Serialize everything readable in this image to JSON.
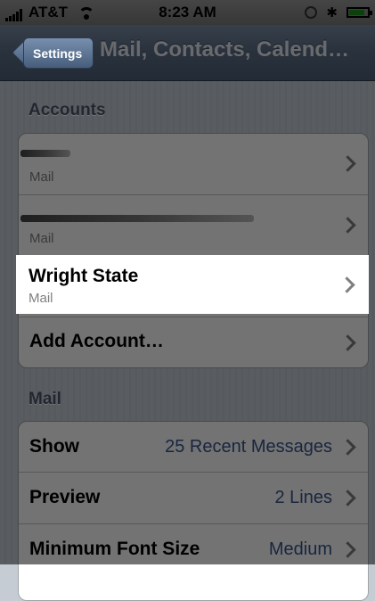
{
  "status_bar": {
    "carrier": "AT&T",
    "time": "8:23 AM",
    "battery_level": 0.9
  },
  "nav": {
    "back_label": "Settings",
    "title": "Mail, Contacts, Calend…"
  },
  "accounts_section": {
    "header": "Accounts",
    "items": [
      {
        "title": "",
        "subtitle": "Mail"
      },
      {
        "title": "",
        "subtitle": "Mail"
      },
      {
        "title": "Wright State",
        "subtitle": "Mail"
      },
      {
        "title": "Add Account…"
      }
    ]
  },
  "mail_section": {
    "header": "Mail",
    "items": [
      {
        "title": "Show",
        "value": "25 Recent Messages"
      },
      {
        "title": "Preview",
        "value": "2 Lines"
      },
      {
        "title": "Minimum Font Size",
        "value": "Medium"
      }
    ]
  }
}
